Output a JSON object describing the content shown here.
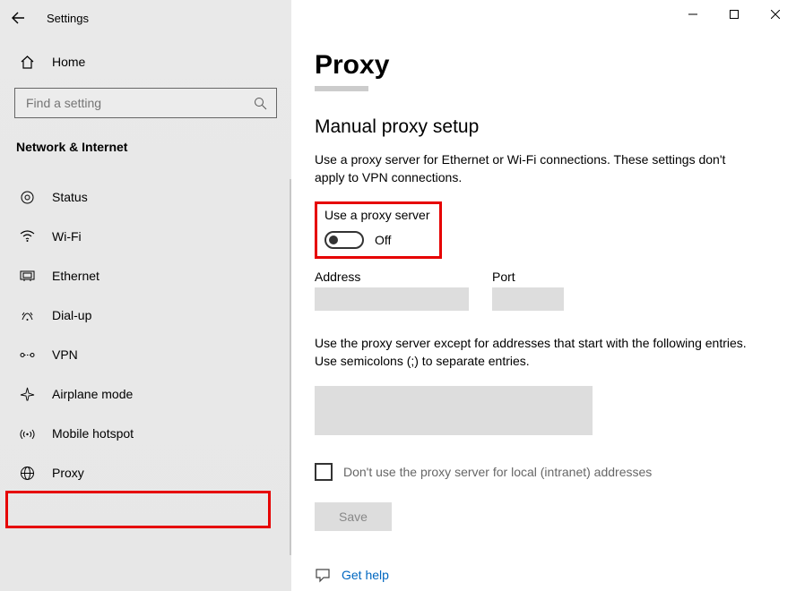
{
  "window": {
    "title": "Settings"
  },
  "sidebar": {
    "home": "Home",
    "search_placeholder": "Find a setting",
    "category": "Network & Internet",
    "items": [
      {
        "label": "Status"
      },
      {
        "label": "Wi-Fi"
      },
      {
        "label": "Ethernet"
      },
      {
        "label": "Dial-up"
      },
      {
        "label": "VPN"
      },
      {
        "label": "Airplane mode"
      },
      {
        "label": "Mobile hotspot"
      },
      {
        "label": "Proxy"
      }
    ]
  },
  "page": {
    "title": "Proxy",
    "section": "Manual proxy setup",
    "section_desc": "Use a proxy server for Ethernet or Wi-Fi connections. These settings don't apply to VPN connections.",
    "toggle_label": "Use a proxy server",
    "toggle_state": "Off",
    "address_label": "Address",
    "port_label": "Port",
    "exceptions_desc": "Use the proxy server except for addresses that start with the following entries. Use semicolons (;) to separate entries.",
    "local_checkbox": "Don't use the proxy server for local (intranet) addresses",
    "save": "Save",
    "help": "Get help"
  }
}
